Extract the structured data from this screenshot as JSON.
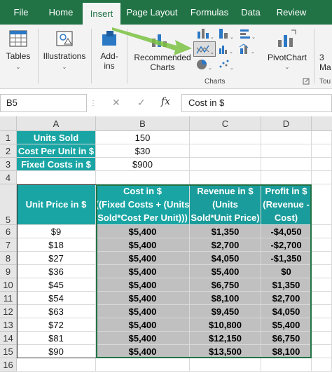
{
  "ribbon": {
    "tabs": [
      "File",
      "Home",
      "Insert",
      "Page Layout",
      "Formulas",
      "Data",
      "Review"
    ],
    "active_tab": "Insert",
    "buttons": {
      "tables": "Tables",
      "illustrations": "Illustrations",
      "addins": "Add-\nins",
      "recommended_charts": "Recommended\nCharts",
      "pivotchart": "PivotChart",
      "threed_maps": "3\nMa"
    },
    "group_labels": {
      "charts": "Charts",
      "tours": "Tou"
    }
  },
  "formula_bar": {
    "name_box": "B5",
    "cancel": "✕",
    "confirm": "✓",
    "fx": "fx",
    "content": "Cost in $"
  },
  "columns": [
    "A",
    "B",
    "C",
    "D"
  ],
  "rows": [
    "1",
    "2",
    "3",
    "4",
    "5",
    "6",
    "7",
    "8",
    "9",
    "10",
    "11",
    "12",
    "13",
    "14",
    "15",
    "16"
  ],
  "inputs": [
    {
      "label": "Units Sold",
      "value": "150"
    },
    {
      "label": "Cost Per Unit in $",
      "value": "$30"
    },
    {
      "label": "Fixed Costs in $",
      "value": "$900"
    }
  ],
  "table": {
    "headers": [
      "Unit Price in $",
      "Cost in $\n((Fixed Costs + (Units\nSold*Cost Per Unit)))",
      "Revenue in $\n(Units\nSold*Unit Price)",
      "Profit in $\n(Revenue -\nCost)"
    ],
    "rows": [
      [
        "$9",
        "$5,400",
        "$1,350",
        "-$4,050"
      ],
      [
        "$18",
        "$5,400",
        "$2,700",
        "-$2,700"
      ],
      [
        "$27",
        "$5,400",
        "$4,050",
        "-$1,350"
      ],
      [
        "$36",
        "$5,400",
        "$5,400",
        "$0"
      ],
      [
        "$45",
        "$5,400",
        "$6,750",
        "$1,350"
      ],
      [
        "$54",
        "$5,400",
        "$8,100",
        "$2,700"
      ],
      [
        "$63",
        "$5,400",
        "$9,450",
        "$4,050"
      ],
      [
        "$72",
        "$5,400",
        "$10,800",
        "$5,400"
      ],
      [
        "$81",
        "$5,400",
        "$12,150",
        "$6,750"
      ],
      [
        "$90",
        "$5,400",
        "$13,500",
        "$8,100"
      ]
    ]
  },
  "colors": {
    "ribbon_green": "#217346",
    "teal": "#1aa5a5",
    "gray_fill": "#c0c0c0"
  }
}
